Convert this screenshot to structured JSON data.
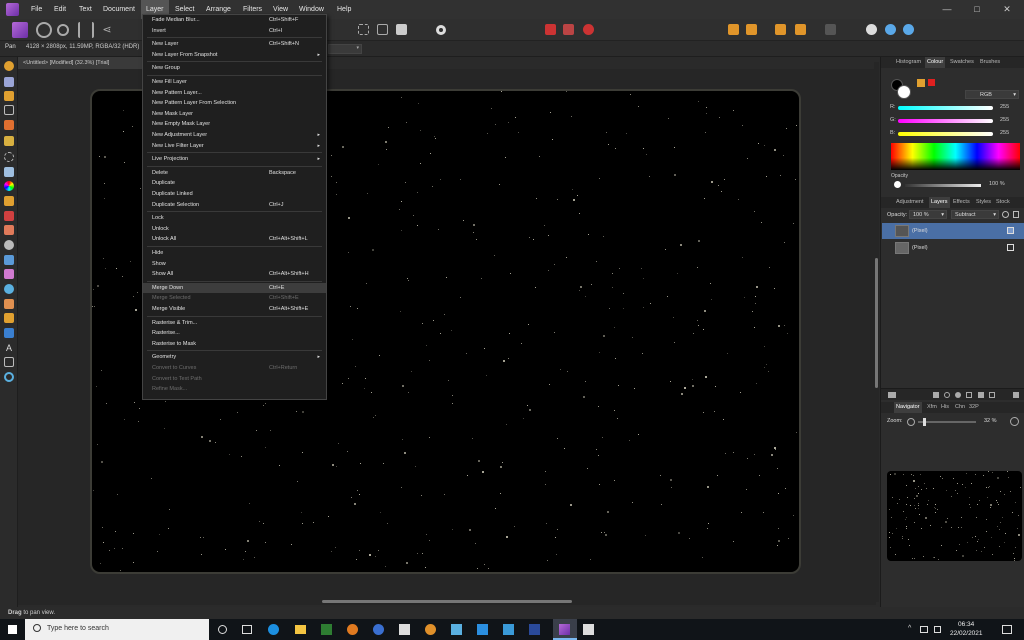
{
  "menubar": {
    "items": [
      "File",
      "Edit",
      "Text",
      "Document",
      "Layer",
      "Select",
      "Arrange",
      "Filters",
      "View",
      "Window",
      "Help"
    ],
    "active": "Layer",
    "min": "—",
    "max": "□",
    "close": "✕"
  },
  "context": {
    "tool": "Pan",
    "info": "4128 × 2808px, 11.59MP, RGBA/32 (HDR)"
  },
  "document": {
    "tab": "<Untitled> [Modified] (32.3%) [Trial]"
  },
  "layer_menu": {
    "items": [
      {
        "label": "Fade Median Blur...",
        "shortcut": "Ctrl+Shift+F"
      },
      {
        "label": "Invert",
        "shortcut": "Ctrl+I"
      },
      {
        "sep": true
      },
      {
        "label": "New Layer",
        "shortcut": "Ctrl+Shift+N"
      },
      {
        "label": "New Layer From Snapshot",
        "arrow": "▸"
      },
      {
        "sep": true
      },
      {
        "label": "New Group"
      },
      {
        "sep": true
      },
      {
        "label": "New Fill Layer"
      },
      {
        "label": "New Pattern Layer..."
      },
      {
        "label": "New Pattern Layer From Selection"
      },
      {
        "label": "New Mask Layer"
      },
      {
        "label": "New Empty Mask Layer"
      },
      {
        "label": "New Adjustment Layer",
        "arrow": "▸"
      },
      {
        "label": "New Live Filter Layer",
        "arrow": "▸"
      },
      {
        "sep": true
      },
      {
        "label": "Live Projection",
        "arrow": "▸"
      },
      {
        "sep": true
      },
      {
        "label": "Delete",
        "shortcut": "Backspace"
      },
      {
        "label": "Duplicate"
      },
      {
        "label": "Duplicate Linked"
      },
      {
        "label": "Duplicate Selection",
        "shortcut": "Ctrl+J"
      },
      {
        "sep": true
      },
      {
        "label": "Lock"
      },
      {
        "label": "Unlock"
      },
      {
        "label": "Unlock All",
        "shortcut": "Ctrl+Alt+Shift+L"
      },
      {
        "sep": true
      },
      {
        "label": "Hide"
      },
      {
        "label": "Show"
      },
      {
        "label": "Show All",
        "shortcut": "Ctrl+Alt+Shift+H"
      },
      {
        "sep": true
      },
      {
        "label": "Merge Down",
        "shortcut": "Ctrl+E",
        "highlighted": true
      },
      {
        "label": "Merge Selected",
        "shortcut": "Ctrl+Shift+E",
        "disabled": true
      },
      {
        "label": "Merge Visible",
        "shortcut": "Ctrl+Alt+Shift+E"
      },
      {
        "sep": true
      },
      {
        "label": "Rasterise & Trim..."
      },
      {
        "label": "Rasterise..."
      },
      {
        "label": "Rasterise to Mask"
      },
      {
        "sep": true
      },
      {
        "label": "Geometry",
        "arrow": "▸"
      },
      {
        "label": "Convert to Curves",
        "shortcut": "Ctrl+Return",
        "disabled": true
      },
      {
        "label": "Convert to Text Path",
        "disabled": true
      },
      {
        "label": "Refine Mask...",
        "disabled": true
      }
    ]
  },
  "colour_panel": {
    "tabs": [
      "Histogram",
      "Colour",
      "Swatches",
      "Brushes"
    ],
    "active": "Colour",
    "mode": "RGB",
    "channels": [
      {
        "label": "R:",
        "value": "255"
      },
      {
        "label": "G:",
        "value": "255"
      },
      {
        "label": "B:",
        "value": "255"
      }
    ],
    "opacity_label": "Opacity",
    "opacity_value": "100 %"
  },
  "layers_panel": {
    "tabs": [
      "Adjustment",
      "Layers",
      "Effects",
      "Styles",
      "Stock"
    ],
    "active": "Layers",
    "opacity_label": "Opacity:",
    "opacity_value": "100 %",
    "blend_mode": "Subtract",
    "layers": [
      {
        "name": "(Pixel)",
        "selected": true
      },
      {
        "name": "(Pixel)",
        "selected": false
      }
    ]
  },
  "navigator_panel": {
    "tabs": [
      "Navigator",
      "Xfm",
      "His",
      "Chn",
      "32P"
    ],
    "active": "Navigator",
    "zoom_label": "Zoom:",
    "zoom_value": "32 %"
  },
  "status": {
    "bold": "Drag",
    "rest": " to pan view."
  },
  "taskbar": {
    "search_placeholder": "Type here to search",
    "time": "06:34",
    "date": "22/02/2021"
  },
  "colors": {
    "accent": "#4a6fa5",
    "menu_highlight": "#3d3d3d",
    "affinity_purple": "#8e44c9"
  }
}
